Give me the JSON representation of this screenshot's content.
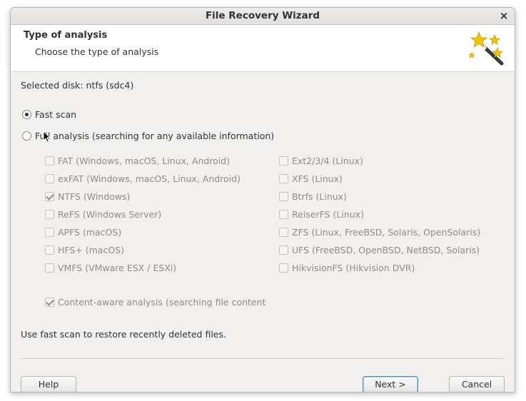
{
  "window": {
    "title": "File Recovery Wizard",
    "close_glyph": "×"
  },
  "header": {
    "title": "Type of analysis",
    "subtitle": "Choose the type of analysis",
    "icon": "magic-wand-icon"
  },
  "selected_disk": "Selected disk: ntfs (sdc4)",
  "options": {
    "fast_scan": {
      "label": "Fast scan",
      "checked": true
    },
    "full_analysis": {
      "label": "Full analysis (searching for any available information)",
      "checked": false
    }
  },
  "filesystems_left": [
    {
      "label": "FAT (Windows, macOS, Linux, Android)",
      "checked": false
    },
    {
      "label": "exFAT (Windows, macOS, Linux, Android)",
      "checked": false
    },
    {
      "label": "NTFS (Windows)",
      "checked": true
    },
    {
      "label": "ReFS (Windows Server)",
      "checked": false
    },
    {
      "label": "APFS (macOS)",
      "checked": false
    },
    {
      "label": "HFS+ (macOS)",
      "checked": false
    },
    {
      "label": "VMFS (VMware ESX / ESXi)",
      "checked": false
    }
  ],
  "filesystems_right": [
    {
      "label": "Ext2/3/4 (Linux)",
      "checked": false
    },
    {
      "label": "XFS (Linux)",
      "checked": false
    },
    {
      "label": "Btrfs (Linux)",
      "checked": false
    },
    {
      "label": "ReiserFS (Linux)",
      "checked": false
    },
    {
      "label": "ZFS (Linux, FreeBSD, Solaris, OpenSolaris)",
      "checked": false
    },
    {
      "label": "UFS (FreeBSD, OpenBSD, NetBSD, Solaris)",
      "checked": false
    },
    {
      "label": "HikvisionFS (Hikvision DVR)",
      "checked": false
    }
  ],
  "content_aware": {
    "label": "Content-aware analysis (searching file content",
    "checked": true
  },
  "hint": "Use fast scan to restore recently deleted files.",
  "buttons": {
    "help": "Help",
    "next": "Next >",
    "cancel": "Cancel"
  }
}
